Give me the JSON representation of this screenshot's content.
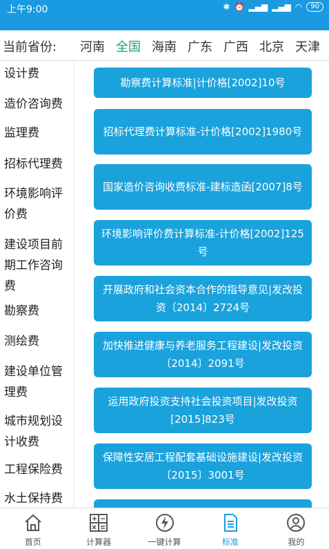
{
  "status": {
    "time": "上午9:00",
    "battery": "90"
  },
  "province": {
    "label": "当前省份:",
    "items": [
      "河南",
      "全国",
      "海南",
      "广东",
      "广西",
      "北京",
      "天津"
    ],
    "active_index": 1
  },
  "sidebar": {
    "items": [
      "设计费",
      "造价咨询费",
      "监理费",
      "招标代理费",
      "环境影响评\n价费",
      "建设项目前\n期工作咨询\n费",
      "勘察费",
      "测绘费",
      "建设单位管\n理费",
      "城市规划设\n计收费",
      "工程保险费",
      "水土保持费"
    ]
  },
  "standards": {
    "items": [
      "勘察费计算标准|计价格[2002]10号",
      "招标代理费计算标准-计价格[2002]1980号",
      "国家造价咨询收费标准-建标造函[2007]8号",
      "环境影响评价费计算标准-计价格[2002]125号",
      "开展政府和社会资本合作的指导意见|发改投资〔2014〕2724号",
      "加快推进健康与养老服务工程建设|发改投资〔2014〕2091号",
      "运用政府投资支持社会投资项目|发改投资[2015]823号",
      "保障性安居工程配套基础设施建设|发改投资〔2015〕3001号"
    ]
  },
  "nav": {
    "items": [
      {
        "label": "首页",
        "icon": "home-icon"
      },
      {
        "label": "计算器",
        "icon": "calculator-icon"
      },
      {
        "label": "一键计算",
        "icon": "lightning-icon"
      },
      {
        "label": "标准",
        "icon": "document-icon"
      },
      {
        "label": "我的",
        "icon": "user-icon"
      }
    ],
    "active_index": 3
  },
  "colors": {
    "accent": "#1a9ae0",
    "button": "#1aa2dc",
    "active_province": "#1aa06b"
  }
}
